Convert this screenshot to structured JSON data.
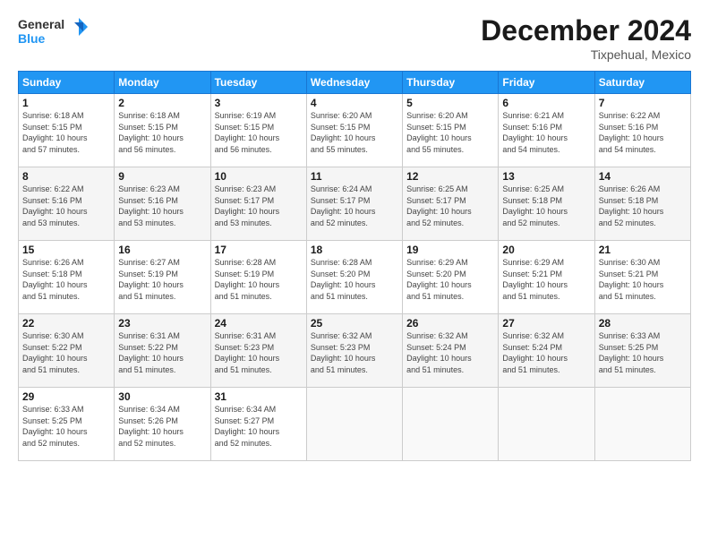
{
  "logo": {
    "line1": "General",
    "line2": "Blue"
  },
  "title": "December 2024",
  "subtitle": "Tixpehual, Mexico",
  "headers": [
    "Sunday",
    "Monday",
    "Tuesday",
    "Wednesday",
    "Thursday",
    "Friday",
    "Saturday"
  ],
  "weeks": [
    [
      {
        "day": "1",
        "rise": "6:18 AM",
        "set": "5:15 PM",
        "daylight": "10 hours and 57 minutes."
      },
      {
        "day": "2",
        "rise": "6:18 AM",
        "set": "5:15 PM",
        "daylight": "10 hours and 56 minutes."
      },
      {
        "day": "3",
        "rise": "6:19 AM",
        "set": "5:15 PM",
        "daylight": "10 hours and 56 minutes."
      },
      {
        "day": "4",
        "rise": "6:20 AM",
        "set": "5:15 PM",
        "daylight": "10 hours and 55 minutes."
      },
      {
        "day": "5",
        "rise": "6:20 AM",
        "set": "5:15 PM",
        "daylight": "10 hours and 55 minutes."
      },
      {
        "day": "6",
        "rise": "6:21 AM",
        "set": "5:16 PM",
        "daylight": "10 hours and 54 minutes."
      },
      {
        "day": "7",
        "rise": "6:22 AM",
        "set": "5:16 PM",
        "daylight": "10 hours and 54 minutes."
      }
    ],
    [
      {
        "day": "8",
        "rise": "6:22 AM",
        "set": "5:16 PM",
        "daylight": "10 hours and 53 minutes."
      },
      {
        "day": "9",
        "rise": "6:23 AM",
        "set": "5:16 PM",
        "daylight": "10 hours and 53 minutes."
      },
      {
        "day": "10",
        "rise": "6:23 AM",
        "set": "5:17 PM",
        "daylight": "10 hours and 53 minutes."
      },
      {
        "day": "11",
        "rise": "6:24 AM",
        "set": "5:17 PM",
        "daylight": "10 hours and 52 minutes."
      },
      {
        "day": "12",
        "rise": "6:25 AM",
        "set": "5:17 PM",
        "daylight": "10 hours and 52 minutes."
      },
      {
        "day": "13",
        "rise": "6:25 AM",
        "set": "5:18 PM",
        "daylight": "10 hours and 52 minutes."
      },
      {
        "day": "14",
        "rise": "6:26 AM",
        "set": "5:18 PM",
        "daylight": "10 hours and 52 minutes."
      }
    ],
    [
      {
        "day": "15",
        "rise": "6:26 AM",
        "set": "5:18 PM",
        "daylight": "10 hours and 51 minutes."
      },
      {
        "day": "16",
        "rise": "6:27 AM",
        "set": "5:19 PM",
        "daylight": "10 hours and 51 minutes."
      },
      {
        "day": "17",
        "rise": "6:28 AM",
        "set": "5:19 PM",
        "daylight": "10 hours and 51 minutes."
      },
      {
        "day": "18",
        "rise": "6:28 AM",
        "set": "5:20 PM",
        "daylight": "10 hours and 51 minutes."
      },
      {
        "day": "19",
        "rise": "6:29 AM",
        "set": "5:20 PM",
        "daylight": "10 hours and 51 minutes."
      },
      {
        "day": "20",
        "rise": "6:29 AM",
        "set": "5:21 PM",
        "daylight": "10 hours and 51 minutes."
      },
      {
        "day": "21",
        "rise": "6:30 AM",
        "set": "5:21 PM",
        "daylight": "10 hours and 51 minutes."
      }
    ],
    [
      {
        "day": "22",
        "rise": "6:30 AM",
        "set": "5:22 PM",
        "daylight": "10 hours and 51 minutes."
      },
      {
        "day": "23",
        "rise": "6:31 AM",
        "set": "5:22 PM",
        "daylight": "10 hours and 51 minutes."
      },
      {
        "day": "24",
        "rise": "6:31 AM",
        "set": "5:23 PM",
        "daylight": "10 hours and 51 minutes."
      },
      {
        "day": "25",
        "rise": "6:32 AM",
        "set": "5:23 PM",
        "daylight": "10 hours and 51 minutes."
      },
      {
        "day": "26",
        "rise": "6:32 AM",
        "set": "5:24 PM",
        "daylight": "10 hours and 51 minutes."
      },
      {
        "day": "27",
        "rise": "6:32 AM",
        "set": "5:24 PM",
        "daylight": "10 hours and 51 minutes."
      },
      {
        "day": "28",
        "rise": "6:33 AM",
        "set": "5:25 PM",
        "daylight": "10 hours and 51 minutes."
      }
    ],
    [
      {
        "day": "29",
        "rise": "6:33 AM",
        "set": "5:25 PM",
        "daylight": "10 hours and 52 minutes."
      },
      {
        "day": "30",
        "rise": "6:34 AM",
        "set": "5:26 PM",
        "daylight": "10 hours and 52 minutes."
      },
      {
        "day": "31",
        "rise": "6:34 AM",
        "set": "5:27 PM",
        "daylight": "10 hours and 52 minutes."
      },
      null,
      null,
      null,
      null
    ]
  ],
  "labels": {
    "sunrise": "Sunrise:",
    "sunset": "Sunset:",
    "daylight": "Daylight: "
  }
}
